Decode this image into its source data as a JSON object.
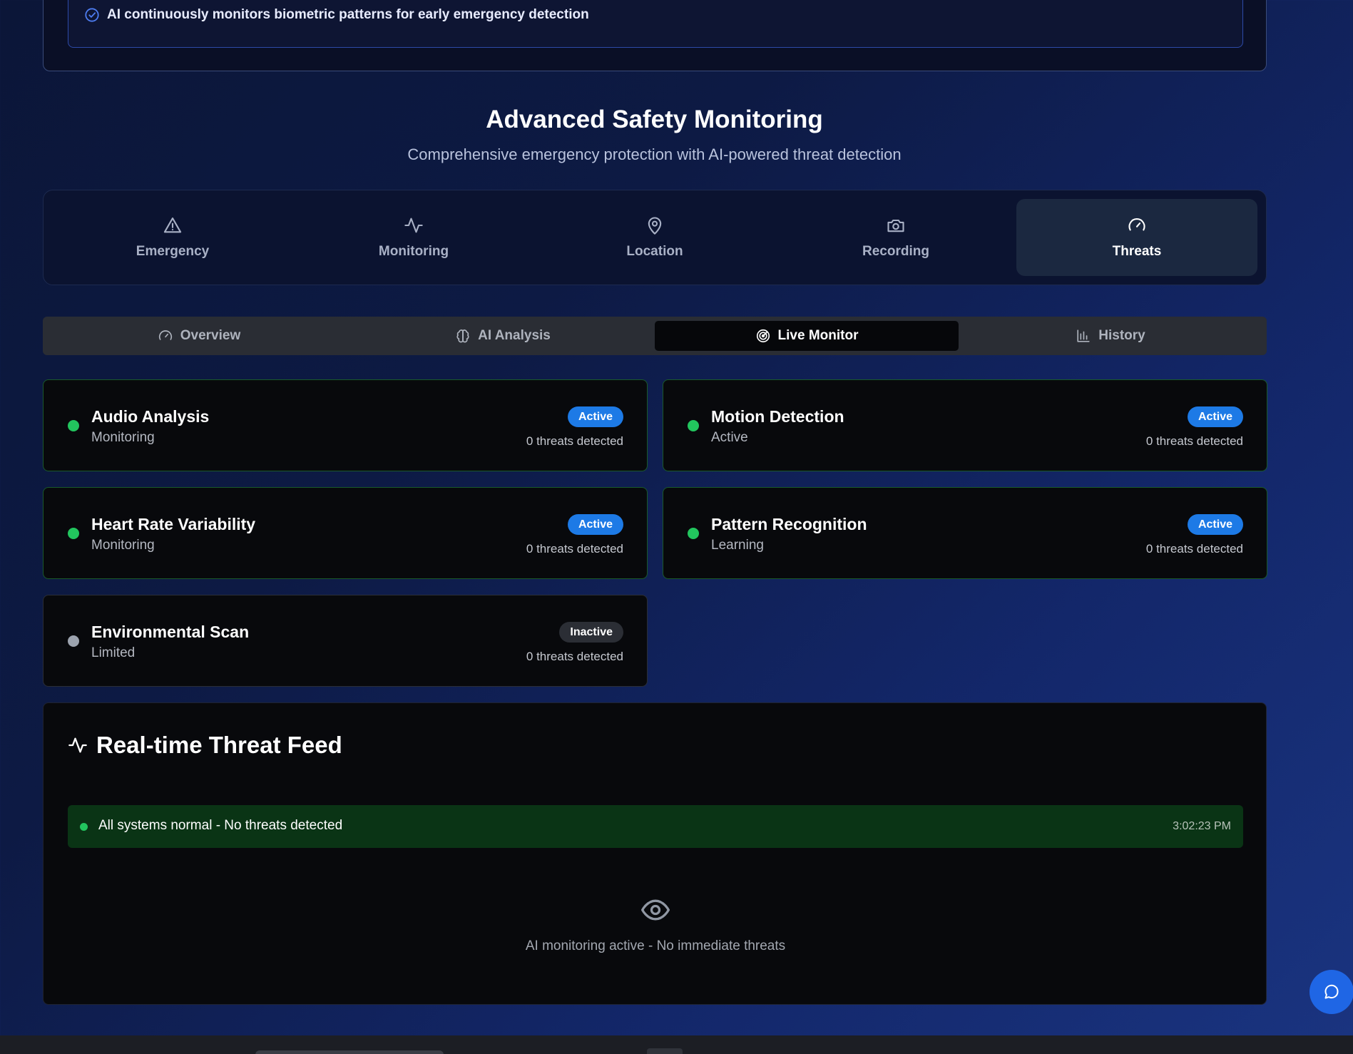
{
  "notice": {
    "text": "AI continuously monitors biometric patterns for early emergency detection",
    "icon": "check-circle-icon"
  },
  "header": {
    "title": "Advanced Safety Monitoring",
    "subtitle": "Comprehensive emergency protection with AI-powered threat detection"
  },
  "main_nav": [
    {
      "label": "Emergency",
      "icon": "alert-triangle-icon",
      "active": false
    },
    {
      "label": "Monitoring",
      "icon": "activity-icon",
      "active": false
    },
    {
      "label": "Location",
      "icon": "map-pin-icon",
      "active": false
    },
    {
      "label": "Recording",
      "icon": "camera-icon",
      "active": false
    },
    {
      "label": "Threats",
      "icon": "gauge-icon",
      "active": true
    }
  ],
  "sub_tabs": [
    {
      "label": "Overview",
      "icon": "gauge-icon",
      "active": false
    },
    {
      "label": "AI Analysis",
      "icon": "brain-icon",
      "active": false
    },
    {
      "label": "Live Monitor",
      "icon": "radar-icon",
      "active": true
    },
    {
      "label": "History",
      "icon": "bar-chart-icon",
      "active": false
    }
  ],
  "monitors": [
    {
      "name": "Audio Analysis",
      "state": "Monitoring",
      "badge": "Active",
      "count": "0 threats detected"
    },
    {
      "name": "Motion Detection",
      "state": "Active",
      "badge": "Active",
      "count": "0 threats detected"
    },
    {
      "name": "Heart Rate Variability",
      "state": "Monitoring",
      "badge": "Active",
      "count": "0 threats detected"
    },
    {
      "name": "Pattern Recognition",
      "state": "Learning",
      "badge": "Active",
      "count": "0 threats detected"
    },
    {
      "name": "Environmental Scan",
      "state": "Limited",
      "badge": "Inactive",
      "count": "0 threats detected"
    }
  ],
  "feed": {
    "title": "Real-time Threat Feed",
    "entries": [
      {
        "message": "All systems normal - No threats detected",
        "time": "3:02:23 PM"
      }
    ],
    "empty_text": "AI monitoring active - No immediate threats"
  },
  "colors": {
    "accent": "#1d7ae6",
    "status_ok": "#22c55e",
    "status_off": "#9ca3af",
    "feed_ok_bg": "#0a3415"
  }
}
